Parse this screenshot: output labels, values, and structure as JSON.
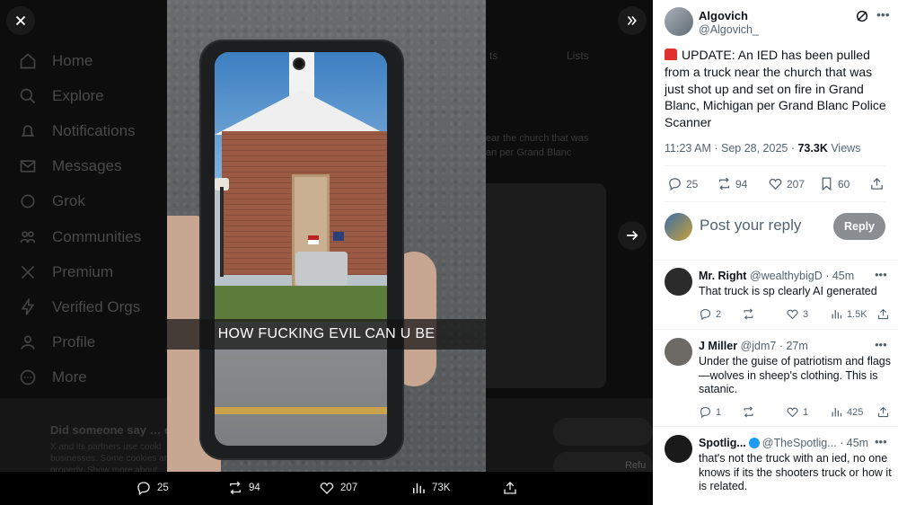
{
  "background": {
    "nav": [
      "Home",
      "Explore",
      "Notifications",
      "Messages",
      "Grok",
      "Communities",
      "Premium",
      "Verified Orgs",
      "Profile",
      "More"
    ],
    "cookie_title": "Did someone say … c",
    "cookie_text": "X and its partners use cooki businesses. Some cookies are properly. Show more about",
    "tab_label": "ts",
    "tab_label2": "Lists",
    "partial_text_1": "ear the church that was",
    "partial_text_2": "an per Grand Blanc",
    "refuse_label": "Refu"
  },
  "media": {
    "caption": "HOW FUCKING EVIL CAN U BE"
  },
  "media_actions": {
    "replies": "25",
    "reposts": "94",
    "likes": "207",
    "views": "73K"
  },
  "tweet": {
    "author_name": "Algovich",
    "author_handle": "@Algovich_",
    "text": "UPDATE: An IED has been pulled from a truck near the church that was just shot up and set on fire in Grand Blanc, Michigan per Grand Blanc Police Scanner",
    "time": "11:23 AM · Sep 28, 2025 · ",
    "views": "73.3K",
    "views_label": " Views",
    "replies": "25",
    "reposts": "94",
    "likes": "207",
    "bookmarks": "60"
  },
  "reply_box": {
    "placeholder": "Post your reply",
    "button": "Reply"
  },
  "replies": [
    {
      "name": "Mr. Right",
      "handle": "@wealthybigD",
      "time": "· 45m",
      "text": "That truck is sp clearly AI generated",
      "comments": "2",
      "reposts": "",
      "likes": "3",
      "views": "1.5K",
      "avatar_color": "#2b2b2b"
    },
    {
      "name": "J Miller",
      "handle": "@jdm7",
      "time": "· 27m",
      "text": "Under the guise of patriotism and flags—wolves in sheep's clothing. This is satanic.",
      "comments": "1",
      "reposts": "",
      "likes": "1",
      "views": "425",
      "avatar_color": "#6d6a66"
    },
    {
      "name": "Spotlig...",
      "handle": "@TheSpotlig...",
      "time": "· 45m",
      "text": "that's not the truck with an ied, no one knows if its the shooters truck or how it is related.",
      "comments": "",
      "reposts": "",
      "likes": "",
      "views": "",
      "avatar_color": "#1a1a1a"
    }
  ],
  "colors": {
    "accent": "#1d9bf0",
    "alert": "#e03131",
    "reply_button": "#8a8e92"
  },
  "icons": [
    "close-icon",
    "collapse-icon",
    "next-arrow-icon",
    "reply-icon",
    "repost-icon",
    "like-icon",
    "views-icon",
    "share-icon",
    "bookmark-icon",
    "grok-icon",
    "more-icon",
    "verified-icon",
    "alert-icon"
  ]
}
